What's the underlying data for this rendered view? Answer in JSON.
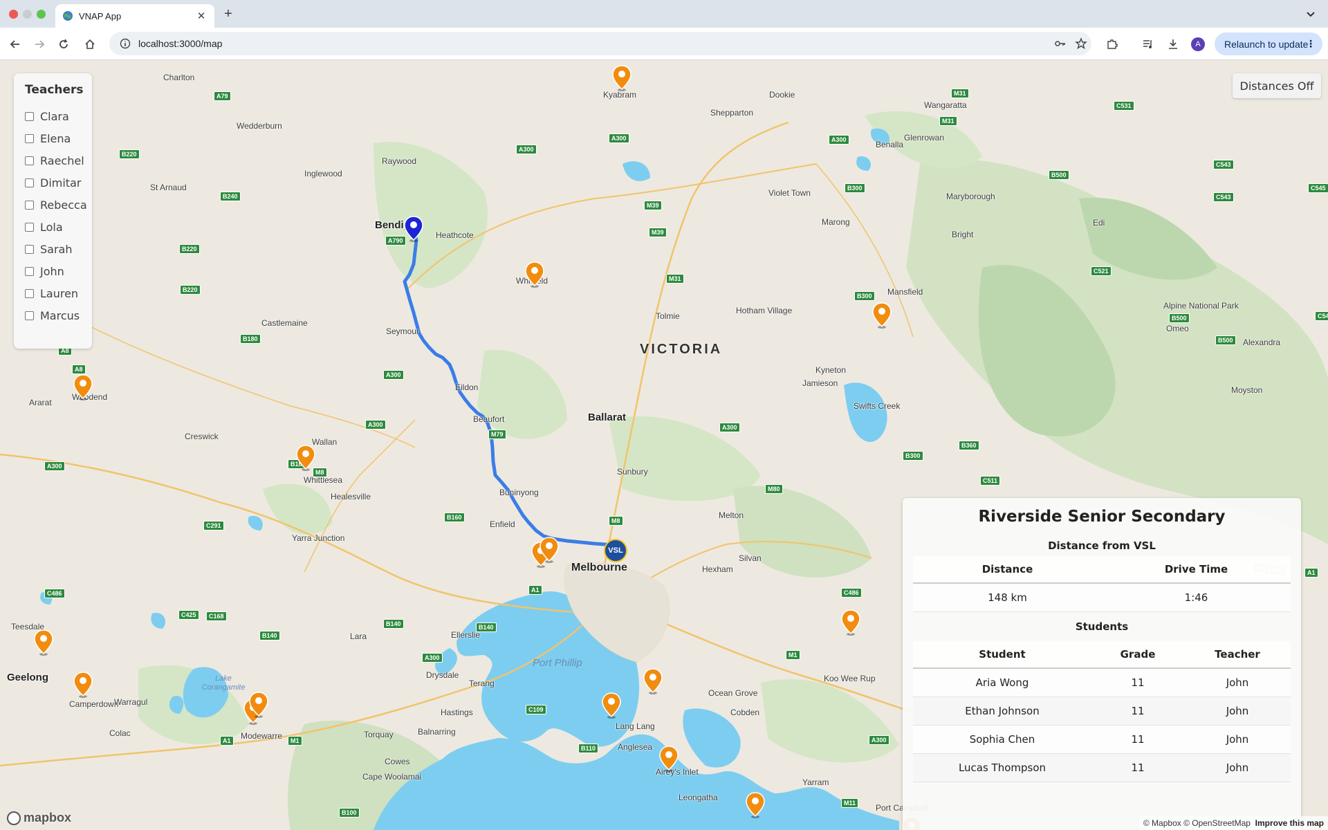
{
  "browser": {
    "tab_title": "VNAP App",
    "url": "localhost:3000/map",
    "relaunch_label": "Relaunch to update",
    "avatar_letter": "A"
  },
  "map": {
    "state_label": "VICTORIA",
    "places": [
      {
        "name": "Charlton"
      },
      {
        "name": "Wedderburn"
      },
      {
        "name": "Kyabram"
      },
      {
        "name": "Dookie"
      },
      {
        "name": "Shepparton"
      },
      {
        "name": "Wangaratta"
      },
      {
        "name": "Raywood"
      },
      {
        "name": "Inglewood"
      },
      {
        "name": "St Arnaud"
      },
      {
        "name": "Glenrowan"
      },
      {
        "name": "Benalla"
      },
      {
        "name": "Violet Town"
      },
      {
        "name": "Marong"
      },
      {
        "name": "Bendigo"
      },
      {
        "name": "Heathcote"
      },
      {
        "name": "Whitfield"
      },
      {
        "name": "Bright"
      },
      {
        "name": "Edi"
      },
      {
        "name": "Maryborough"
      },
      {
        "name": "Castlemaine"
      },
      {
        "name": "Seymour"
      },
      {
        "name": "Tolmie"
      },
      {
        "name": "Mansfield"
      },
      {
        "name": "Hotham Village"
      },
      {
        "name": "Alpine National Park"
      },
      {
        "name": "Omeo"
      },
      {
        "name": "Alexandra"
      },
      {
        "name": "Kyneton"
      },
      {
        "name": "Eildon"
      },
      {
        "name": "Jamieson"
      },
      {
        "name": "Swifts Creek"
      },
      {
        "name": "Moyston"
      },
      {
        "name": "Ararat"
      },
      {
        "name": "Woodend"
      },
      {
        "name": "Beaufort"
      },
      {
        "name": "Creswick"
      },
      {
        "name": "Wallan"
      },
      {
        "name": "Ballarat"
      },
      {
        "name": "Whittlesea"
      },
      {
        "name": "Sunbury"
      },
      {
        "name": "Buninyong"
      },
      {
        "name": "Healesville"
      },
      {
        "name": "Melton"
      },
      {
        "name": "Enfield"
      },
      {
        "name": "Yarra Junction"
      },
      {
        "name": "Silvan"
      },
      {
        "name": "Hexham"
      },
      {
        "name": "Teesdale"
      },
      {
        "name": "Lara"
      },
      {
        "name": "Ellerslie"
      },
      {
        "name": "Geelong"
      },
      {
        "name": "Drysdale"
      },
      {
        "name": "Terang"
      },
      {
        "name": "Camperdown"
      },
      {
        "name": "Warragul"
      },
      {
        "name": "Koo Wee Rup"
      },
      {
        "name": "Ocean Grove"
      },
      {
        "name": "Hastings"
      },
      {
        "name": "Lang Lang"
      },
      {
        "name": "Cobden"
      },
      {
        "name": "Colac"
      },
      {
        "name": "Modewarre"
      },
      {
        "name": "Torquay"
      },
      {
        "name": "Balnarring"
      },
      {
        "name": "Anglesea"
      },
      {
        "name": "Cowes"
      },
      {
        "name": "Airey's Inlet"
      },
      {
        "name": "Cape Woolamai"
      },
      {
        "name": "Leongatha"
      },
      {
        "name": "Yarram"
      },
      {
        "name": "Port Campbell"
      }
    ],
    "melbourne_label": "Melbourne",
    "water": [
      {
        "name": "Port Phillip"
      },
      {
        "name": "Lake Corangamite"
      }
    ],
    "roads": [
      "A79",
      "B220",
      "B240",
      "A300",
      "A300",
      "A300",
      "A790",
      "B220",
      "B220",
      "M39",
      "M39",
      "M31",
      "M31",
      "M31",
      "B300",
      "C531",
      "B500",
      "C543",
      "C545",
      "C543",
      "C521",
      "B300",
      "B500",
      "B500",
      "C545",
      "B180",
      "A300",
      "A300",
      "A8",
      "A8",
      "A300",
      "M79",
      "B180",
      "M8",
      "C291",
      "B160",
      "M8",
      "A300",
      "M80",
      "B300",
      "B360",
      "C511",
      "C486",
      "C486",
      "C425",
      "C168",
      "B140",
      "B140",
      "B140",
      "A300",
      "M1",
      "A300",
      "M1",
      "A1",
      "A1",
      "C109",
      "B110",
      "M11",
      "A440",
      "A1",
      "M1",
      "B100"
    ],
    "vsl_label": "VSL",
    "mapbox_label": "mapbox",
    "attribution_copyright": "© Mapbox © OpenStreetMap",
    "attribution_link": "Improve this map"
  },
  "teachers": {
    "title": "Teachers",
    "list": [
      "Clara",
      "Elena",
      "Raechel",
      "Dimitar",
      "Rebecca",
      "Lola",
      "Sarah",
      "John",
      "Lauren",
      "Marcus"
    ]
  },
  "distances_button": "Distances Off",
  "school": {
    "name": "Riverside Senior Secondary",
    "distance_section": "Distance from VSL",
    "distance_header": "Distance",
    "drive_time_header": "Drive Time",
    "distance": "148 km",
    "drive_time": "1:46",
    "students_section": "Students",
    "students_headers": [
      "Student",
      "Grade",
      "Teacher"
    ],
    "students": [
      {
        "name": "Aria Wong",
        "grade": "11",
        "teacher": "John"
      },
      {
        "name": "Ethan Johnson",
        "grade": "11",
        "teacher": "John"
      },
      {
        "name": "Sophia Chen",
        "grade": "11",
        "teacher": "John"
      },
      {
        "name": "Lucas Thompson",
        "grade": "11",
        "teacher": "John"
      }
    ]
  },
  "colors": {
    "route": "#3b7de8",
    "pin": "#f28c0f",
    "selected_pin": "#1c24d6",
    "water": "#7dcdf0",
    "land": "#ede9e0",
    "park": "#cfe5c4"
  }
}
